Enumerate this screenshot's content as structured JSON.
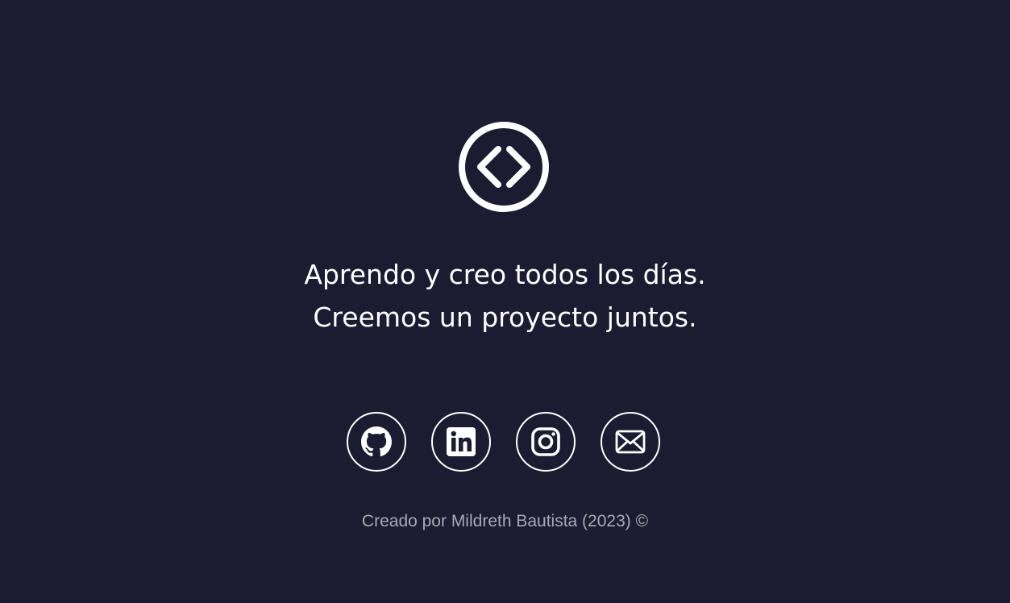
{
  "logo": {
    "icon": "code-brackets-icon"
  },
  "tagline": {
    "line1": "Aprendo y creo todos los días.",
    "line2": "Creemos un proyecto juntos."
  },
  "socials": [
    {
      "name": "GitHub",
      "icon": "github-icon"
    },
    {
      "name": "LinkedIn",
      "icon": "linkedin-icon"
    },
    {
      "name": "Instagram",
      "icon": "instagram-icon"
    },
    {
      "name": "Email",
      "icon": "mail-icon"
    }
  ],
  "credit": "Creado por Mildreth Bautista (2023) ©",
  "colors": {
    "background": "#1c1b31",
    "text": "#ffffff",
    "muted": "#a8a8b8"
  }
}
